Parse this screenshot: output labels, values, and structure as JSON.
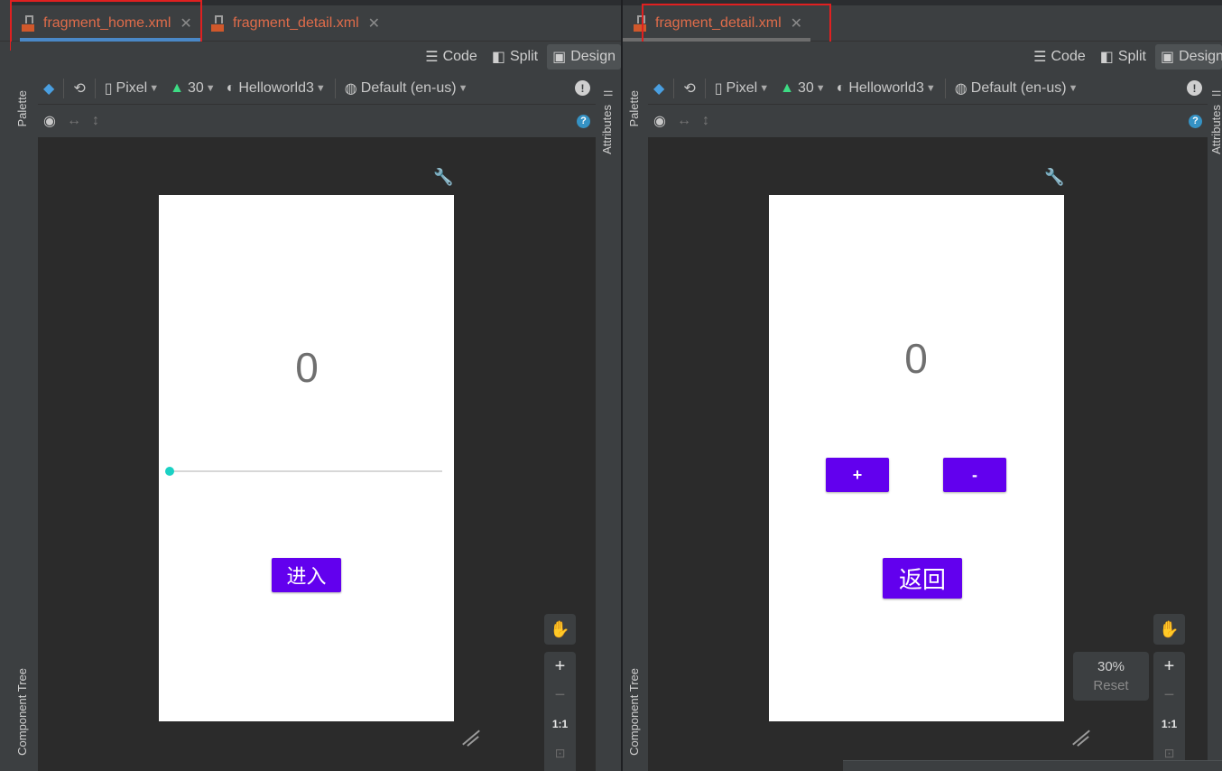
{
  "left_pane": {
    "tabs": [
      {
        "label": "fragment_home.xml",
        "close": "✕"
      },
      {
        "label": "fragment_detail.xml",
        "close": "✕"
      }
    ],
    "modes": {
      "code": "Code",
      "split": "Split",
      "design": "Design"
    },
    "sidebar": {
      "palette": "Palette",
      "component_tree": "Component Tree",
      "attributes": "Attributes"
    },
    "toolbar": {
      "device": "Pixel",
      "api": "30",
      "theme": "Helloworld3",
      "locale": "Default (en-us)"
    },
    "preview": {
      "counter": "0",
      "seekbar_progress": 0,
      "enter_button": "进入"
    },
    "zoom": {
      "plus": "+",
      "minus": "−",
      "ratio": "1:1"
    }
  },
  "right_pane": {
    "tabs": [
      {
        "label": "fragment_detail.xml",
        "close": "✕"
      }
    ],
    "modes": {
      "code": "Code",
      "split": "Split",
      "design": "Design"
    },
    "sidebar": {
      "palette": "Palette",
      "component_tree": "Component Tree",
      "attributes": "Attributes"
    },
    "toolbar": {
      "device": "Pixel",
      "api": "30",
      "theme": "Helloworld3",
      "locale": "Default (en-us)"
    },
    "preview": {
      "counter": "0",
      "plus_button": "+",
      "minus_button": "-",
      "back_button": "返回"
    },
    "zoom": {
      "plus": "+",
      "minus": "−",
      "ratio": "1:1",
      "percent": "30%",
      "reset": "Reset"
    }
  },
  "colors": {
    "accent_purple": "#6200ee",
    "seekbar_thumb": "#1ad1c4",
    "tab_text": "#e06c4a",
    "highlight_red": "#e02020",
    "active_tab_underline": "#4a88c7"
  },
  "icons": [
    "file-xml-icon",
    "close-icon",
    "code-mode-icon",
    "split-mode-icon",
    "design-mode-icon",
    "layers-icon",
    "orientation-icon",
    "phone-icon",
    "android-icon",
    "theme-icon",
    "globe-icon",
    "warning-icon",
    "eye-icon",
    "horizontal-resize-icon",
    "vertical-resize-icon",
    "help-icon",
    "wrench-icon",
    "hand-icon",
    "resize-handle-icon"
  ]
}
